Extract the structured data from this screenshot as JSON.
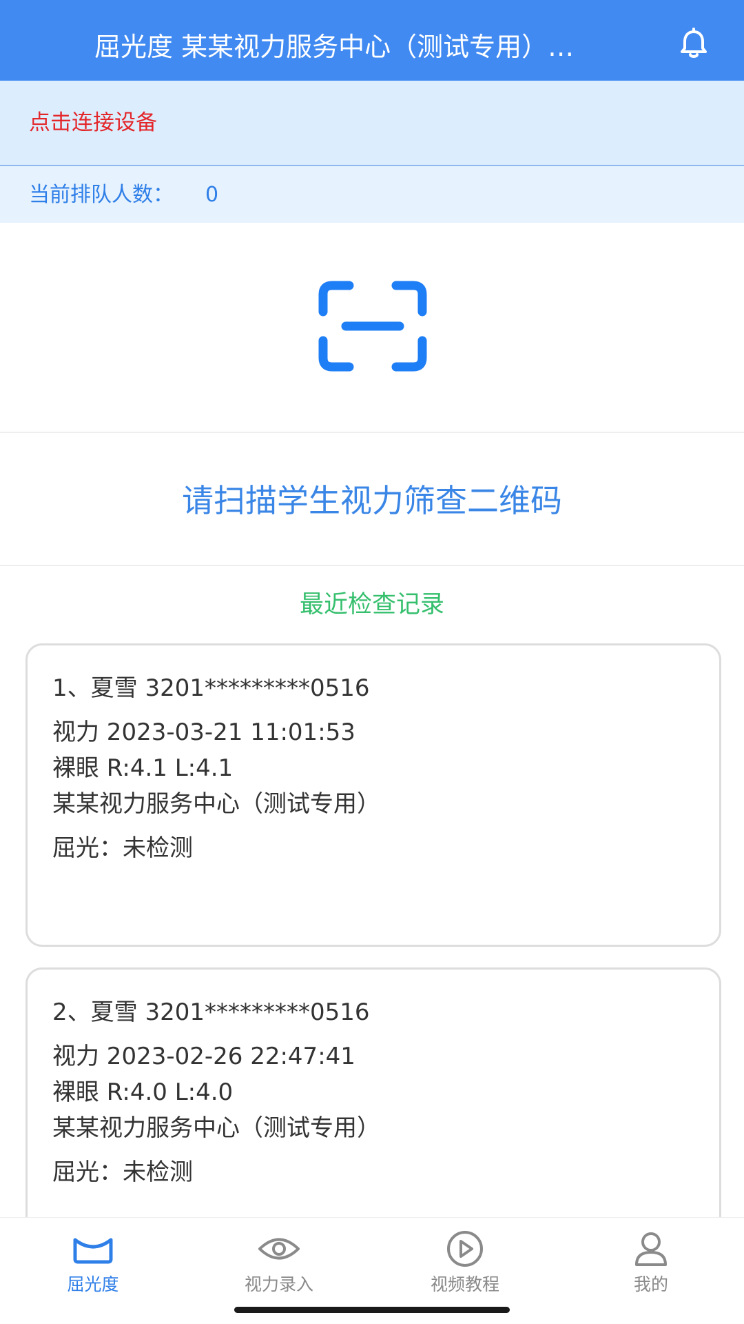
{
  "header": {
    "title": "屈光度 某某视力服务中心（测试专用）…",
    "icon": "bell-icon"
  },
  "device": {
    "connect_label": "点击连接设备"
  },
  "queue": {
    "label": "当前排队人数：",
    "count": "0"
  },
  "scan": {
    "icon": "scan-icon",
    "prompt": "请扫描学生视力筛查二维码"
  },
  "records": {
    "title": "最近检查记录",
    "items": [
      {
        "header": "1、夏雪   3201*********0516",
        "vision": "视力   2023-03-21 11:01:53",
        "naked_eye": "裸眼 R:4.1  L:4.1",
        "center": "某某视力服务中心（测试专用）",
        "refraction": "屈光：未检测"
      },
      {
        "header": "2、夏雪   3201*********0516",
        "vision": "视力   2023-02-26 22:47:41",
        "naked_eye": "裸眼 R:4.0  L:4.0",
        "center": "某某视力服务中心（测试专用）",
        "refraction": "屈光：未检测"
      }
    ]
  },
  "tabs": [
    {
      "label": "屈光度",
      "icon": "refraction-icon",
      "active": true
    },
    {
      "label": "视力录入",
      "icon": "eye-icon",
      "active": false
    },
    {
      "label": "视频教程",
      "icon": "play-icon",
      "active": false
    },
    {
      "label": "我的",
      "icon": "user-icon",
      "active": false
    }
  ],
  "colors": {
    "header_bg": "#418af2",
    "accent_blue": "#2f7fe8",
    "alert_red": "#e3262a",
    "green": "#35bf6d"
  }
}
